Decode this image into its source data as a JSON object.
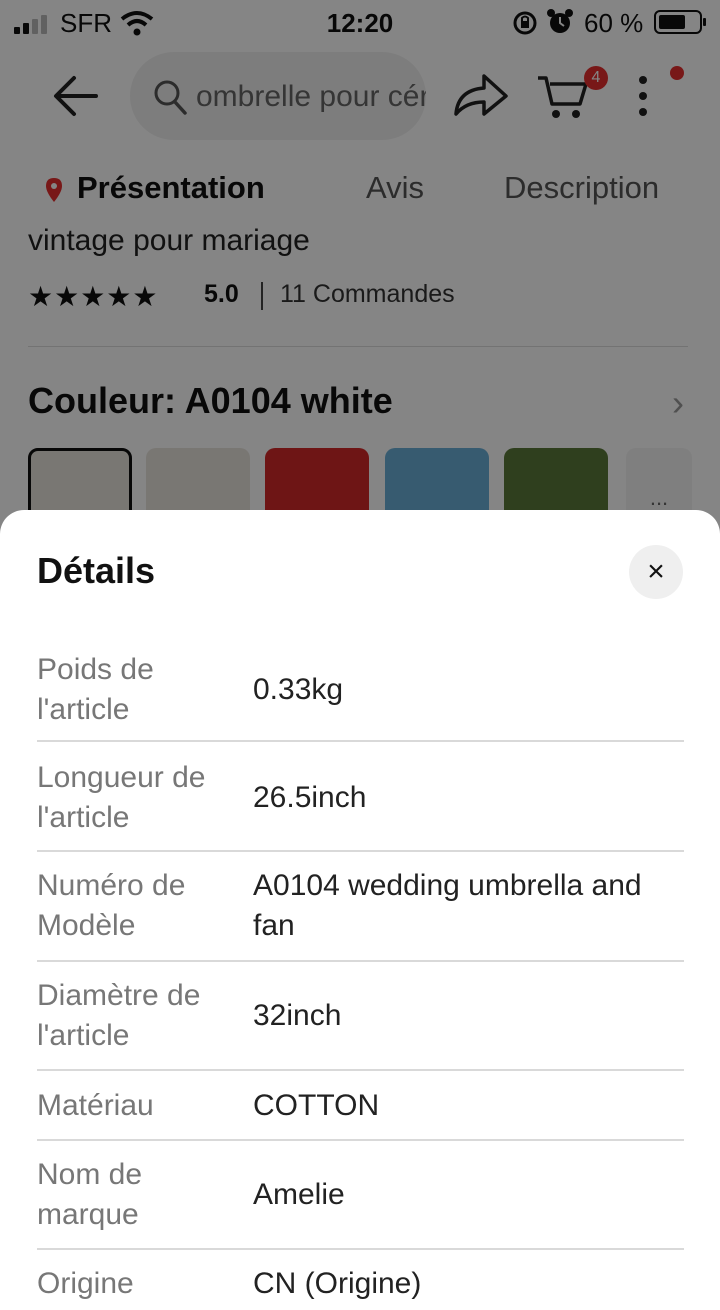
{
  "status_bar": {
    "carrier": "SFR",
    "time": "12:20",
    "battery": "60 %"
  },
  "header": {
    "search_text": "ombrelle pour cérémonie",
    "cart_count": "4",
    "icons": [
      "back-arrow-icon",
      "search-icon",
      "share-icon",
      "cart-icon",
      "more-icon"
    ]
  },
  "tabs": [
    {
      "label": "Présentation",
      "active": true
    },
    {
      "label": "Avis",
      "active": false
    },
    {
      "label": "Description",
      "active": false
    }
  ],
  "product": {
    "title_fragment": "vintage pour mariage",
    "stars": "★★★★★",
    "rating": "5.0",
    "orders": "11 Commandes",
    "color_label": "Couleur: A0104 white",
    "thumbs_more": "..."
  },
  "colors": {
    "accent": "#e62e2e",
    "thumb_white": "#e8e4dc",
    "thumb_red": "#d42a2a",
    "thumb_blue": "#6aaed6",
    "thumb_grass": "#5a7a3a"
  },
  "details": {
    "title": "Détails",
    "close_label": "×",
    "rows": [
      {
        "label": "Poids de l'article",
        "value": "0.33kg"
      },
      {
        "label": "Longueur de l'article",
        "value": "26.5inch"
      },
      {
        "label": "Numéro de Modèle",
        "value": "A0104 wedding umbrella and fan"
      },
      {
        "label": "Diamètre de l'article",
        "value": "32inch"
      },
      {
        "label": "Matériau",
        "value": "COTTON"
      },
      {
        "label": "Nom de marque",
        "value": "Amelie"
      },
      {
        "label": "Origine",
        "value": "CN (Origine)"
      }
    ]
  }
}
